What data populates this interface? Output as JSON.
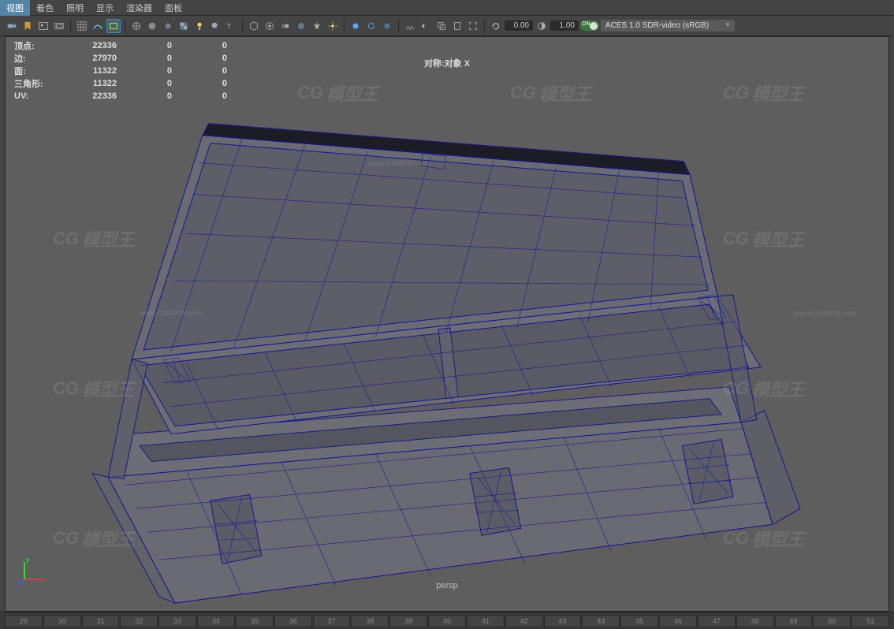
{
  "menubar": {
    "items": [
      "视图",
      "着色",
      "照明",
      "显示",
      "渲染器",
      "面板"
    ]
  },
  "toolbar": {
    "refresh_val": "0.00",
    "time_val": "1.00",
    "toggle_label": "ON",
    "colorspace": "ACES 1.0 SDR-video (sRGB)"
  },
  "stats": {
    "rows": [
      {
        "label": "顶点:",
        "v1": "22336",
        "v2": "0",
        "v3": "0"
      },
      {
        "label": "边:",
        "v1": "27970",
        "v2": "0",
        "v3": "0"
      },
      {
        "label": "面:",
        "v1": "11322",
        "v2": "0",
        "v3": "0"
      },
      {
        "label": "三角形:",
        "v1": "11322",
        "v2": "0",
        "v3": "0"
      },
      {
        "label": "UV:",
        "v1": "22336",
        "v2": "0",
        "v3": "0"
      }
    ]
  },
  "symmetry": "对称:对象 X",
  "camera": "persp",
  "axis": {
    "x": "x",
    "y": "y",
    "z": "z"
  },
  "timeline": [
    "29",
    "30",
    "31",
    "32",
    "33",
    "34",
    "35",
    "36",
    "37",
    "38",
    "39",
    "40",
    "41",
    "42",
    "43",
    "44",
    "45",
    "46",
    "47",
    "48",
    "49",
    "50",
    "51"
  ],
  "watermark": {
    "logo": "CG",
    "text": "模型王",
    "url": "www.CGMXW.com"
  }
}
